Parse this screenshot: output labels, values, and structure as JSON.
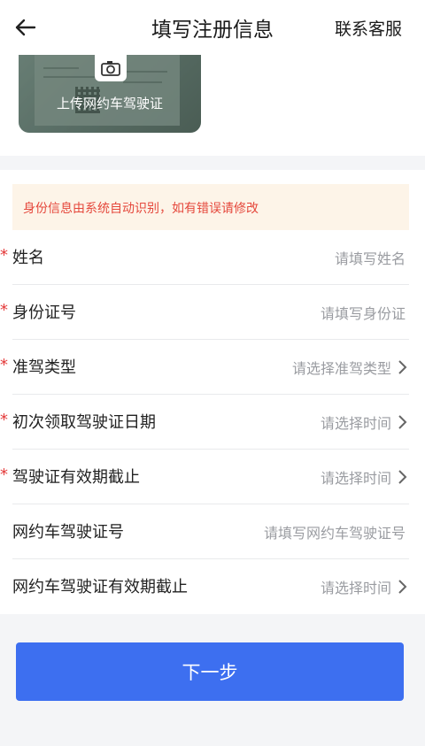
{
  "header": {
    "title": "填写注册信息",
    "service": "联系客服"
  },
  "upload": {
    "label": "上传网约车驾驶证"
  },
  "notice": "身份信息由系统自动识别，如有错误请修改",
  "fields": [
    {
      "label": "姓名",
      "placeholder": "请填写姓名",
      "required": true,
      "type": "input"
    },
    {
      "label": "身份证号",
      "placeholder": "请填写身份证",
      "required": true,
      "type": "input"
    },
    {
      "label": "准驾类型",
      "placeholder": "请选择准驾类型",
      "required": true,
      "type": "select"
    },
    {
      "label": "初次领取驾驶证日期",
      "placeholder": "请选择时间",
      "required": true,
      "type": "select"
    },
    {
      "label": "驾驶证有效期截止",
      "placeholder": "请选择时间",
      "required": true,
      "type": "select"
    },
    {
      "label": "网约车驾驶证号",
      "placeholder": "请填写网约车驾驶证号",
      "required": false,
      "type": "input"
    },
    {
      "label": "网约车驾驶证有效期截止",
      "placeholder": "请选择时间",
      "required": false,
      "type": "select"
    }
  ],
  "required_mark": "*",
  "next_button": "下一步",
  "colors": {
    "primary": "#3d6ff0",
    "required": "#e43a3a",
    "notice_text": "#e5483c",
    "notice_bg": "#fdf4e8"
  }
}
